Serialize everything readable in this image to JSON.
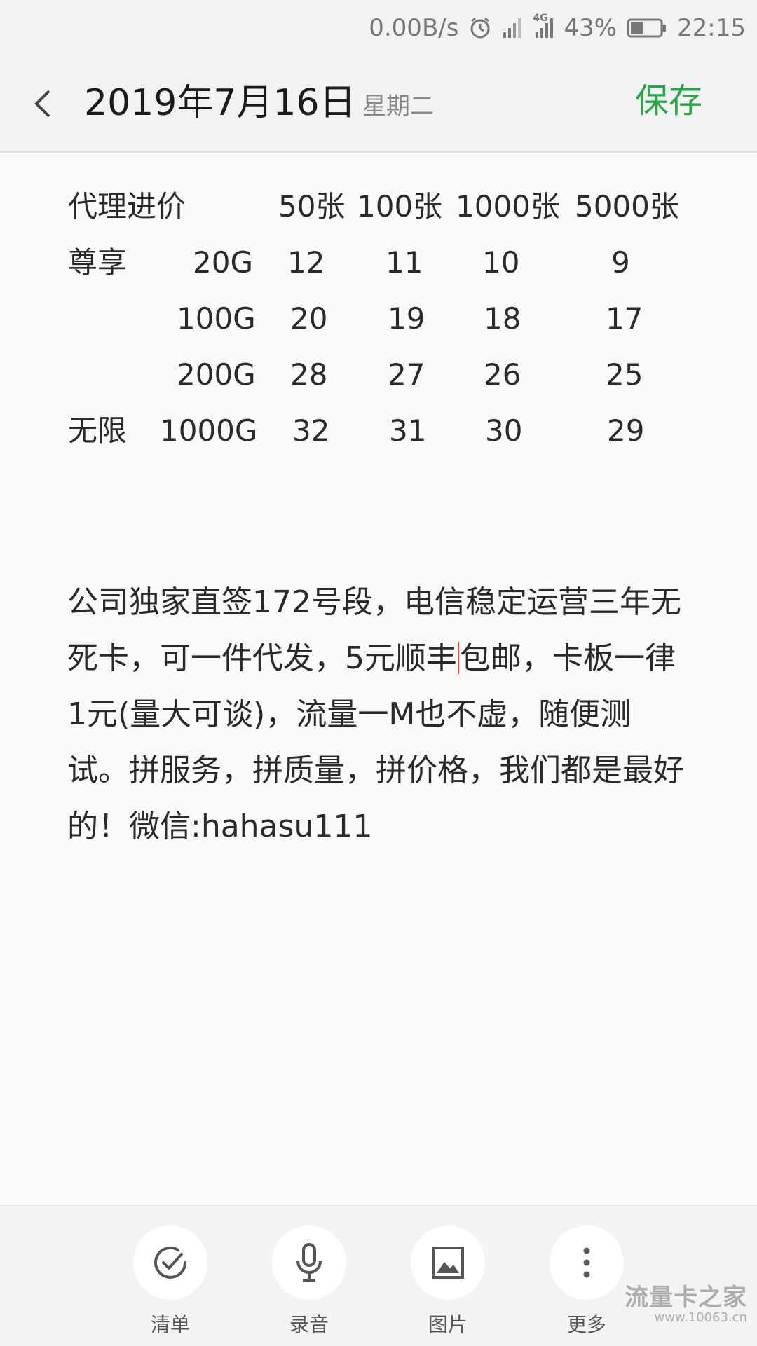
{
  "status_bar": {
    "net_speed": "0.00B/s",
    "network_type": "4G",
    "battery_percent": "43%",
    "battery_level": 0.43,
    "time": "22:15",
    "icons": [
      "alarm-icon",
      "signal-icon",
      "mobile-data-icon",
      "battery-icon"
    ]
  },
  "header": {
    "date": "2019年7月16日",
    "weekday": "星期二",
    "save_label": "保存",
    "accent_color": "#2ea44a"
  },
  "price_table": {
    "header": [
      "代理进价",
      "50张",
      "100张",
      "1000张",
      "5000张"
    ],
    "rows": [
      {
        "group": "尊享",
        "plan": "20G",
        "prices": [
          "12",
          "11",
          "10",
          "9"
        ]
      },
      {
        "group": "",
        "plan": "100G",
        "prices": [
          "20",
          "19",
          "18",
          "17"
        ]
      },
      {
        "group": "",
        "plan": "200G",
        "prices": [
          "28",
          "27",
          "26",
          "25"
        ]
      },
      {
        "group": "无限",
        "plan": "1000G",
        "prices": [
          "32",
          "31",
          "30",
          "29"
        ]
      }
    ]
  },
  "note_paragraph": {
    "before_cursor": "公司独家直签172号段，电信稳定运营三年无死卡，可一件代发，5元顺丰",
    "after_cursor": "包邮，卡板一律1元(量大可谈)，流量一M也不虚，随便测试。拼服务，拼质量，拼价格，我们都是最好的！微信:hahasu111",
    "cursor_color": "#e0443c"
  },
  "toolbar": {
    "items": [
      {
        "label": "清单",
        "icon": "checklist-icon"
      },
      {
        "label": "录音",
        "icon": "microphone-icon"
      },
      {
        "label": "图片",
        "icon": "image-icon"
      },
      {
        "label": "更多",
        "icon": "more-vertical-icon"
      }
    ]
  },
  "watermark": {
    "title": "流量卡之家",
    "url": "www.10063.cn"
  }
}
